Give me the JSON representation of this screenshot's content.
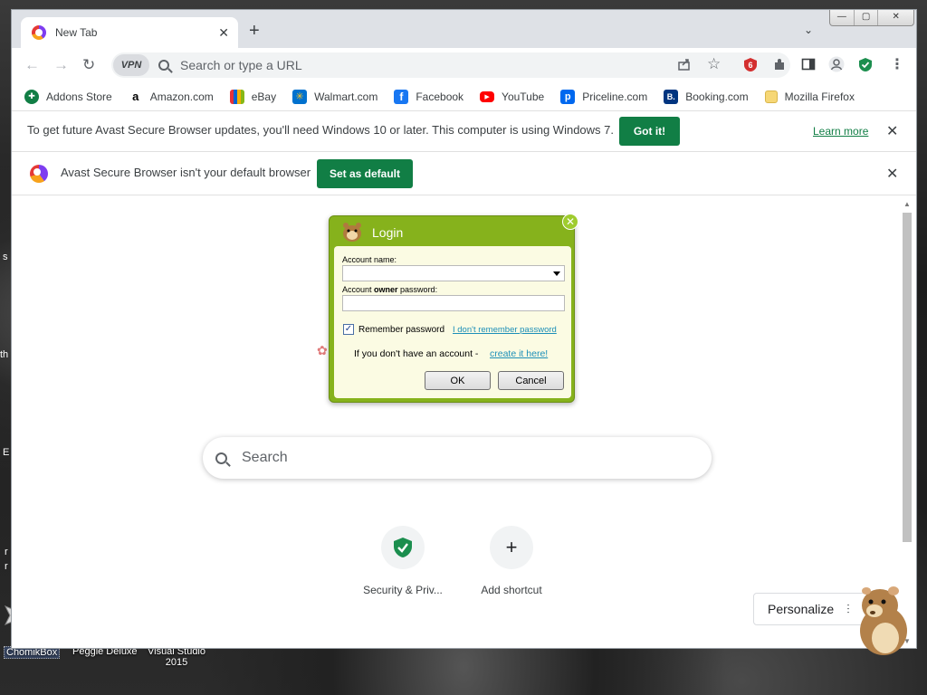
{
  "tab": {
    "title": "New Tab",
    "close": "✕",
    "new_tab": "+",
    "search_tabs": "⌄"
  },
  "window_controls": {
    "minimize": "—",
    "maximize": "▢",
    "close": "✕"
  },
  "toolbar": {
    "back": "←",
    "forward": "→",
    "reload": "↻",
    "vpn_label": "VPN",
    "omnibox_placeholder": "Search or type a URL"
  },
  "bookmarks": [
    {
      "label": "Addons Store",
      "icon": "addons-store-icon",
      "color": "#117e45",
      "glyph": "✚"
    },
    {
      "label": "Amazon.com",
      "icon": "amazon-icon",
      "color": "#ffffff",
      "glyph": "a"
    },
    {
      "label": "eBay",
      "icon": "ebay-icon",
      "color": "#e53238",
      "glyph": "e"
    },
    {
      "label": "Walmart.com",
      "icon": "walmart-icon",
      "color": "#0071ce",
      "glyph": "✳"
    },
    {
      "label": "Facebook",
      "icon": "facebook-icon",
      "color": "#1877f2",
      "glyph": "f"
    },
    {
      "label": "YouTube",
      "icon": "youtube-icon",
      "color": "#ff0000",
      "glyph": "▶"
    },
    {
      "label": "Priceline.com",
      "icon": "priceline-icon",
      "color": "#0068ef",
      "glyph": "p"
    },
    {
      "label": "Booking.com",
      "icon": "booking-icon",
      "color": "#003580",
      "glyph": "B."
    },
    {
      "label": "Mozilla Firefox",
      "icon": "folder-icon",
      "color": "#f6d776",
      "glyph": ""
    }
  ],
  "infobar_update": {
    "text": "To get future Avast Secure Browser updates, you'll need Windows 10 or later. This computer is using Windows 7.",
    "button": "Got it!",
    "link": "Learn more",
    "close": "✕"
  },
  "infobar_default": {
    "text": "Avast Secure Browser isn't your default browser",
    "button": "Set as default",
    "close": "✕"
  },
  "ntp": {
    "search_placeholder": "Search",
    "shortcuts": [
      {
        "label": "Security & Priv...",
        "icon": "shield-check-icon"
      },
      {
        "label": "Add shortcut",
        "icon": "plus-icon"
      }
    ],
    "personalize": "Personalize"
  },
  "login_dialog": {
    "title": "Login",
    "close": "✕",
    "account_name_label": "Account name:",
    "password_label_prefix": "Account ",
    "password_label_bold": "owner",
    "password_label_suffix": " password:",
    "remember_checked": true,
    "remember_label": "Remember password",
    "forgot_link": "I don't remember password",
    "no_account_text": "If you don't have an account -",
    "create_link": "create it here!",
    "ok": "OK",
    "cancel": "Cancel"
  },
  "desktop": {
    "icons": [
      "ChomikBox",
      "Peggle Deluxe",
      "Visual Studio 2015"
    ],
    "edge_letters": [
      "s",
      "th",
      "E",
      "r",
      "r"
    ]
  },
  "colors": {
    "accent_green": "#117e45",
    "dialog_green": "#86b21c",
    "dialog_body": "#fbfbe3"
  }
}
